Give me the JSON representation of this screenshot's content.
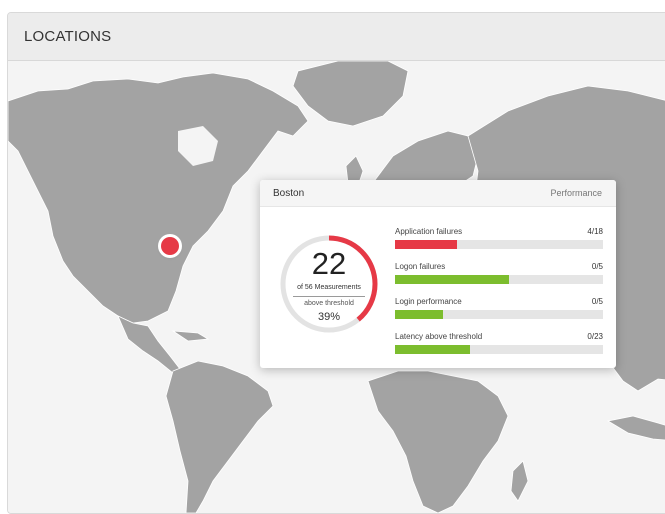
{
  "panel": {
    "title": "LOCATIONS"
  },
  "popup": {
    "city": "Boston",
    "tab_label": "Performance",
    "gauge": {
      "count": "22",
      "of_text": "of 56 Measurements",
      "above_text": "above threshold",
      "percent_text": "39%",
      "fraction": 0.39,
      "arc_color": "#e63946",
      "track_color": "#e3e3e3"
    },
    "metrics": [
      {
        "label": "Application failures",
        "value": "4/18",
        "fraction": 0.3,
        "color": "#e63946"
      },
      {
        "label": "Logon failures",
        "value": "0/5",
        "fraction": 0.55,
        "color": "#7cbd2e"
      },
      {
        "label": "Login performance",
        "value": "0/5",
        "fraction": 0.23,
        "color": "#7cbd2e"
      },
      {
        "label": "Latency above threshold",
        "value": "0/23",
        "fraction": 0.36,
        "color": "#7cbd2e"
      }
    ]
  },
  "map": {
    "marker_city": "Boston",
    "marker_color": "#e63946",
    "land_color": "#a3a3a3"
  }
}
